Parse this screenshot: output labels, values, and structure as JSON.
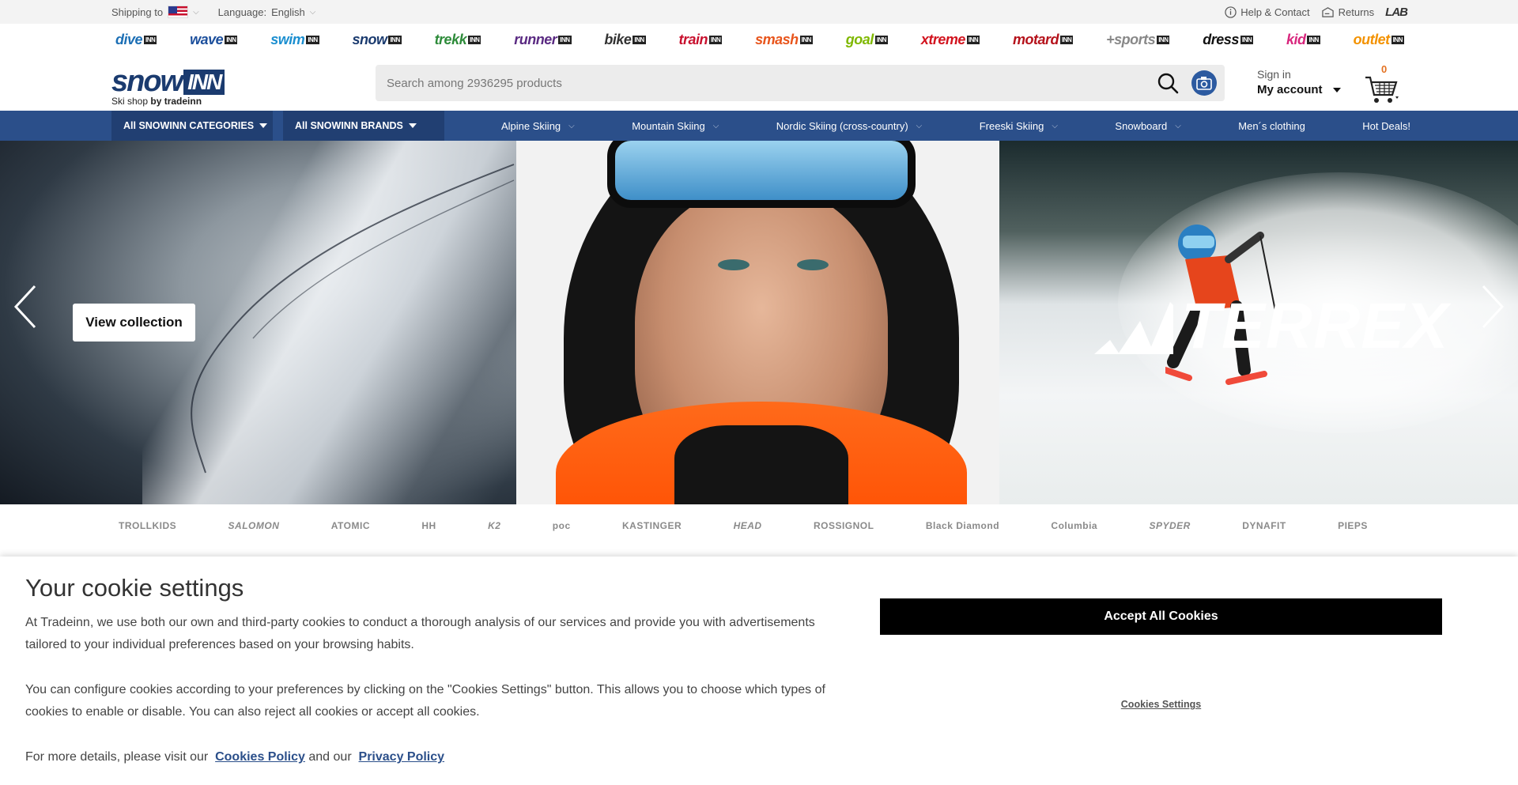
{
  "topbar": {
    "shipping_label": "Shipping to",
    "language_label": "Language:",
    "language_value": "English",
    "help": "Help & Contact",
    "returns": "Returns",
    "lab": "LAB"
  },
  "stores": [
    {
      "name": "dive",
      "color": "#1c6fb5"
    },
    {
      "name": "wave",
      "color": "#1c4f9c"
    },
    {
      "name": "swim",
      "color": "#1c8fd0"
    },
    {
      "name": "snow",
      "color": "#1b3b6f"
    },
    {
      "name": "trekk",
      "color": "#2e8b3a"
    },
    {
      "name": "runner",
      "color": "#5a2a82"
    },
    {
      "name": "bike",
      "color": "#333333"
    },
    {
      "name": "train",
      "color": "#c8102e"
    },
    {
      "name": "smash",
      "color": "#e8551c"
    },
    {
      "name": "goal",
      "color": "#7fb800"
    },
    {
      "name": "xtreme",
      "color": "#d2141f"
    },
    {
      "name": "motard",
      "color": "#b5121b"
    },
    {
      "name": "+sports",
      "color": "#888888"
    },
    {
      "name": "dress",
      "color": "#111111"
    },
    {
      "name": "kid",
      "color": "#d8267d"
    },
    {
      "name": "outlet",
      "color": "#f39200"
    }
  ],
  "stores_inn_label": "INN",
  "logo": {
    "word": "snow",
    "inn": "INN",
    "sub_prefix": "Ski shop",
    "sub_bold": "by tradeinn"
  },
  "search": {
    "placeholder": "Search among 2936295 products"
  },
  "account": {
    "sign_in": "Sign in",
    "my_account": "My account"
  },
  "cart": {
    "count": "0"
  },
  "nav": {
    "categories": "All SNOWINN CATEGORIES",
    "brands": "All SNOWINN BRANDS",
    "links": [
      {
        "label": "Alpine Skiing",
        "chevron": true
      },
      {
        "label": "Mountain Skiing",
        "chevron": true
      },
      {
        "label": "Nordic Skiing (cross-country)",
        "chevron": true
      },
      {
        "label": "Freeski Skiing",
        "chevron": true
      },
      {
        "label": "Snowboard",
        "chevron": true
      },
      {
        "label": "Men´s clothing",
        "chevron": false
      },
      {
        "label": "Hot Deals!",
        "chevron": false
      }
    ]
  },
  "hero": {
    "view_collection": "View collection",
    "brand_text": "TERREX"
  },
  "brands": [
    {
      "name": "TROLLKIDS",
      "italic": false
    },
    {
      "name": "SALOMON",
      "italic": true
    },
    {
      "name": "ATOMIC",
      "italic": false
    },
    {
      "name": "HH",
      "italic": false
    },
    {
      "name": "K2",
      "italic": true
    },
    {
      "name": "poc",
      "italic": false
    },
    {
      "name": "KASTINGER",
      "italic": false
    },
    {
      "name": "HEAD",
      "italic": true
    },
    {
      "name": "ROSSIGNOL",
      "italic": false
    },
    {
      "name": "Black Diamond",
      "italic": false
    },
    {
      "name": "Columbia",
      "italic": false
    },
    {
      "name": "SPYDER",
      "italic": true
    },
    {
      "name": "DYNAFIT",
      "italic": false
    },
    {
      "name": "PIEPS",
      "italic": false
    }
  ],
  "cookie": {
    "title": "Your cookie settings",
    "p1": "At Tradeinn, we use both our own and third-party cookies to conduct a thorough analysis of our services and provide you with advertisements tailored to your individual preferences based on your browsing habits.",
    "p2": "You can configure cookies according to your preferences by clicking on the \"Cookies Settings\" button. This allows you to choose which types of cookies to enable or disable. You can also reject all cookies or accept all cookies.",
    "p3_prefix": "For more details, please visit our",
    "cookies_policy": "Cookies Policy",
    "and_our": "and our",
    "privacy_policy": "Privacy Policy",
    "accept": "Accept All Cookies",
    "settings": "Cookies Settings"
  }
}
